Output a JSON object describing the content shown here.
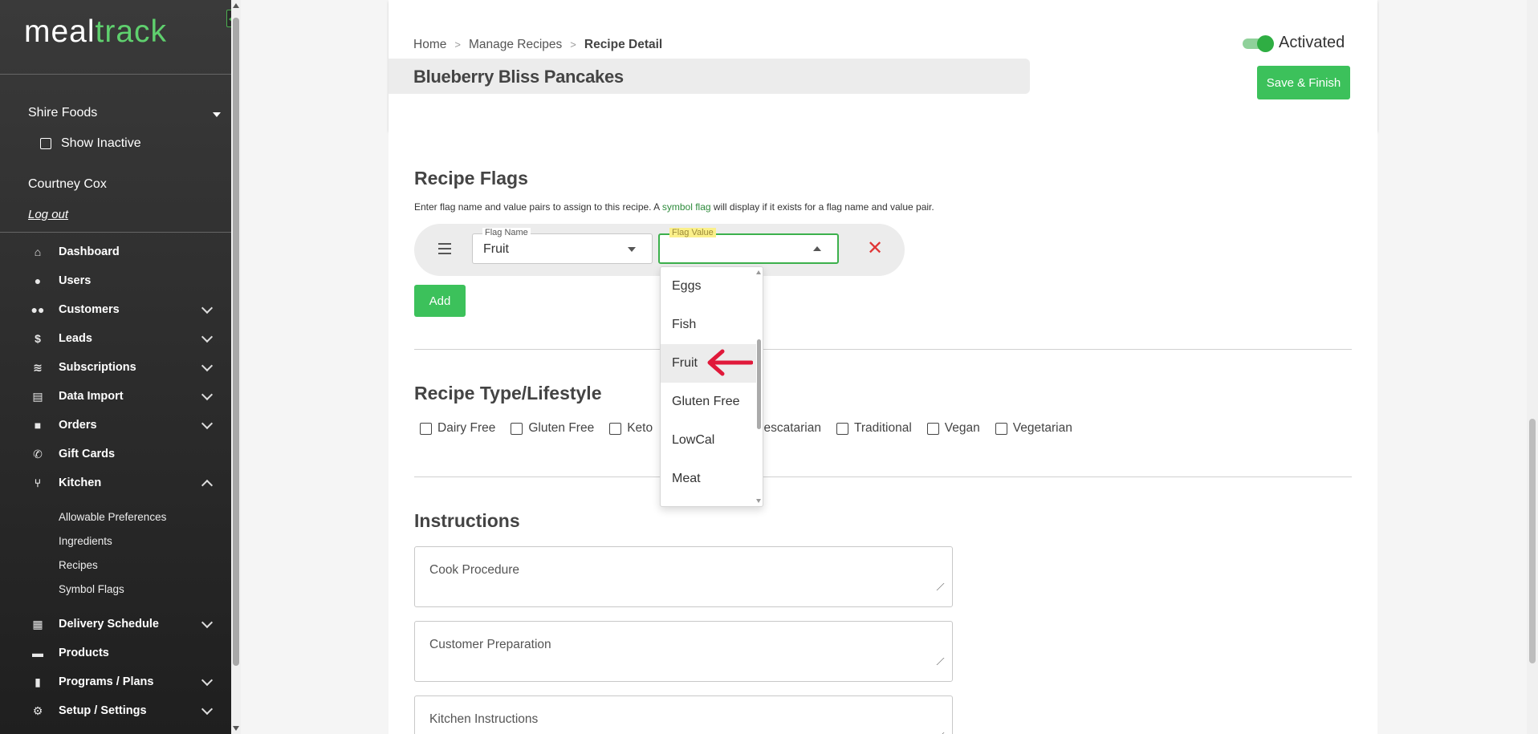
{
  "sidebar": {
    "logo_part1": "meal",
    "logo_part2": "track",
    "organization": "Shire Foods",
    "show_inactive_label": "Show Inactive",
    "user_name": "Courtney Cox",
    "logout_label": "Log out",
    "nav": [
      {
        "label": "Dashboard",
        "icon": "home-icon"
      },
      {
        "label": "Users",
        "icon": "user-icon"
      },
      {
        "label": "Customers",
        "icon": "users-icon"
      },
      {
        "label": "Leads",
        "icon": "dollar-icon"
      },
      {
        "label": "Subscriptions",
        "icon": "layers-icon"
      },
      {
        "label": "Data Import",
        "icon": "file-icon"
      },
      {
        "label": "Orders",
        "icon": "bag-icon"
      },
      {
        "label": "Gift Cards",
        "icon": "phone-icon"
      },
      {
        "label": "Kitchen",
        "icon": "utensils-icon"
      },
      {
        "label": "Delivery Schedule",
        "icon": "calendar-icon"
      },
      {
        "label": "Products",
        "icon": "box-icon"
      },
      {
        "label": "Programs / Plans",
        "icon": "clipboard-icon"
      },
      {
        "label": "Setup / Settings",
        "icon": "gear-icon"
      }
    ],
    "kitchen_sub": [
      "Allowable Preferences",
      "Ingredients",
      "Recipes",
      "Symbol Flags"
    ]
  },
  "header": {
    "breadcrumb": [
      "Home",
      "Manage Recipes",
      "Recipe Detail"
    ],
    "breadcrumb_sep": ">",
    "recipe_title": "Blueberry Bliss Pancakes",
    "status_label": "Activated",
    "save_label": "Save & Finish"
  },
  "flags": {
    "title": "Recipe Flags",
    "help_pre": "Enter flag name and value pairs to assign to this recipe. A ",
    "help_link": "symbol flag",
    "help_post": " will display if it exists for a flag name and value pair.",
    "flag_name_label": "Flag Name",
    "flag_name_value": "Fruit",
    "flag_value_label": "Flag Value",
    "flag_value_value": "",
    "add_label": "Add",
    "remove_glyph": "✕",
    "dropdown_options": [
      "Eggs",
      "Fish",
      "Fruit",
      "Gluten Free",
      "LowCal",
      "Meat"
    ],
    "highlighted_option": "Fruit"
  },
  "types": {
    "title": "Recipe Type/Lifestyle",
    "options": [
      "Dairy Free",
      "Gluten Free",
      "Keto",
      "Pescatarian",
      "Traditional",
      "Vegan",
      "Vegetarian"
    ]
  },
  "instructions": {
    "title": "Instructions",
    "fields": [
      "Cook Procedure",
      "Customer Preparation",
      "Kitchen Instructions"
    ]
  },
  "colors": {
    "accent": "#3cc15b",
    "logo_accent": "#5fd06e",
    "danger": "#e03535",
    "link": "#2e8b3c"
  }
}
